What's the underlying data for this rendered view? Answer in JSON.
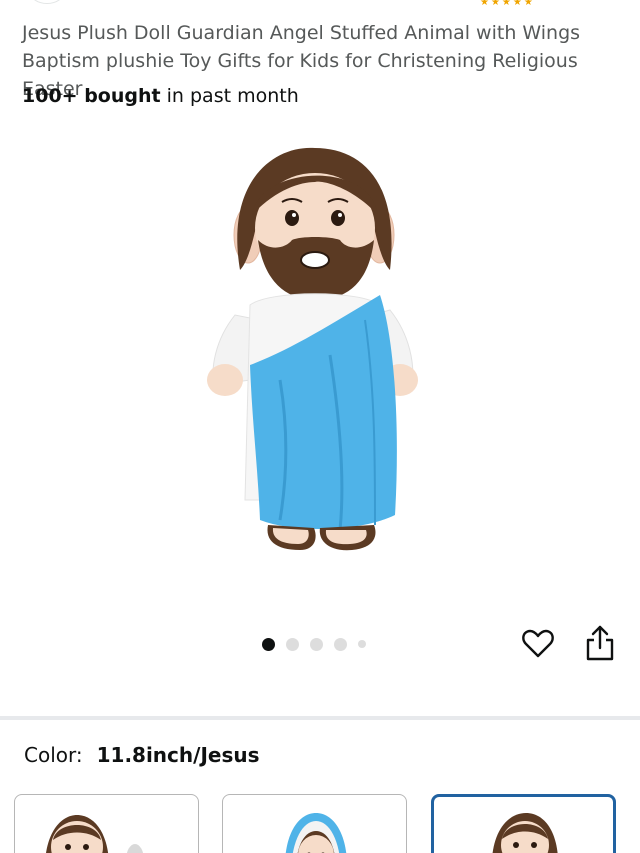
{
  "product": {
    "title": "Jesus Plush Doll Guardian Angel Stuffed Animal with Wings Baptism plushie Toy Gifts for Kids for Christening Religious Easter",
    "bought_bold": "100+ bought",
    "bought_rest": " in past month"
  },
  "gallery": {
    "image_count": 5,
    "active_index": 0,
    "wishlist_icon": "heart-outline-icon",
    "share_icon": "share-icon"
  },
  "variation": {
    "label": "Color:",
    "selected_value": "11.8inch/Jesus",
    "selected_index": 2
  },
  "colors": {
    "brown_hair": "#5b3a23",
    "robe_blue": "#4fb3e8",
    "skin": "#f6dcc9",
    "selected_border": "#2162a1"
  }
}
